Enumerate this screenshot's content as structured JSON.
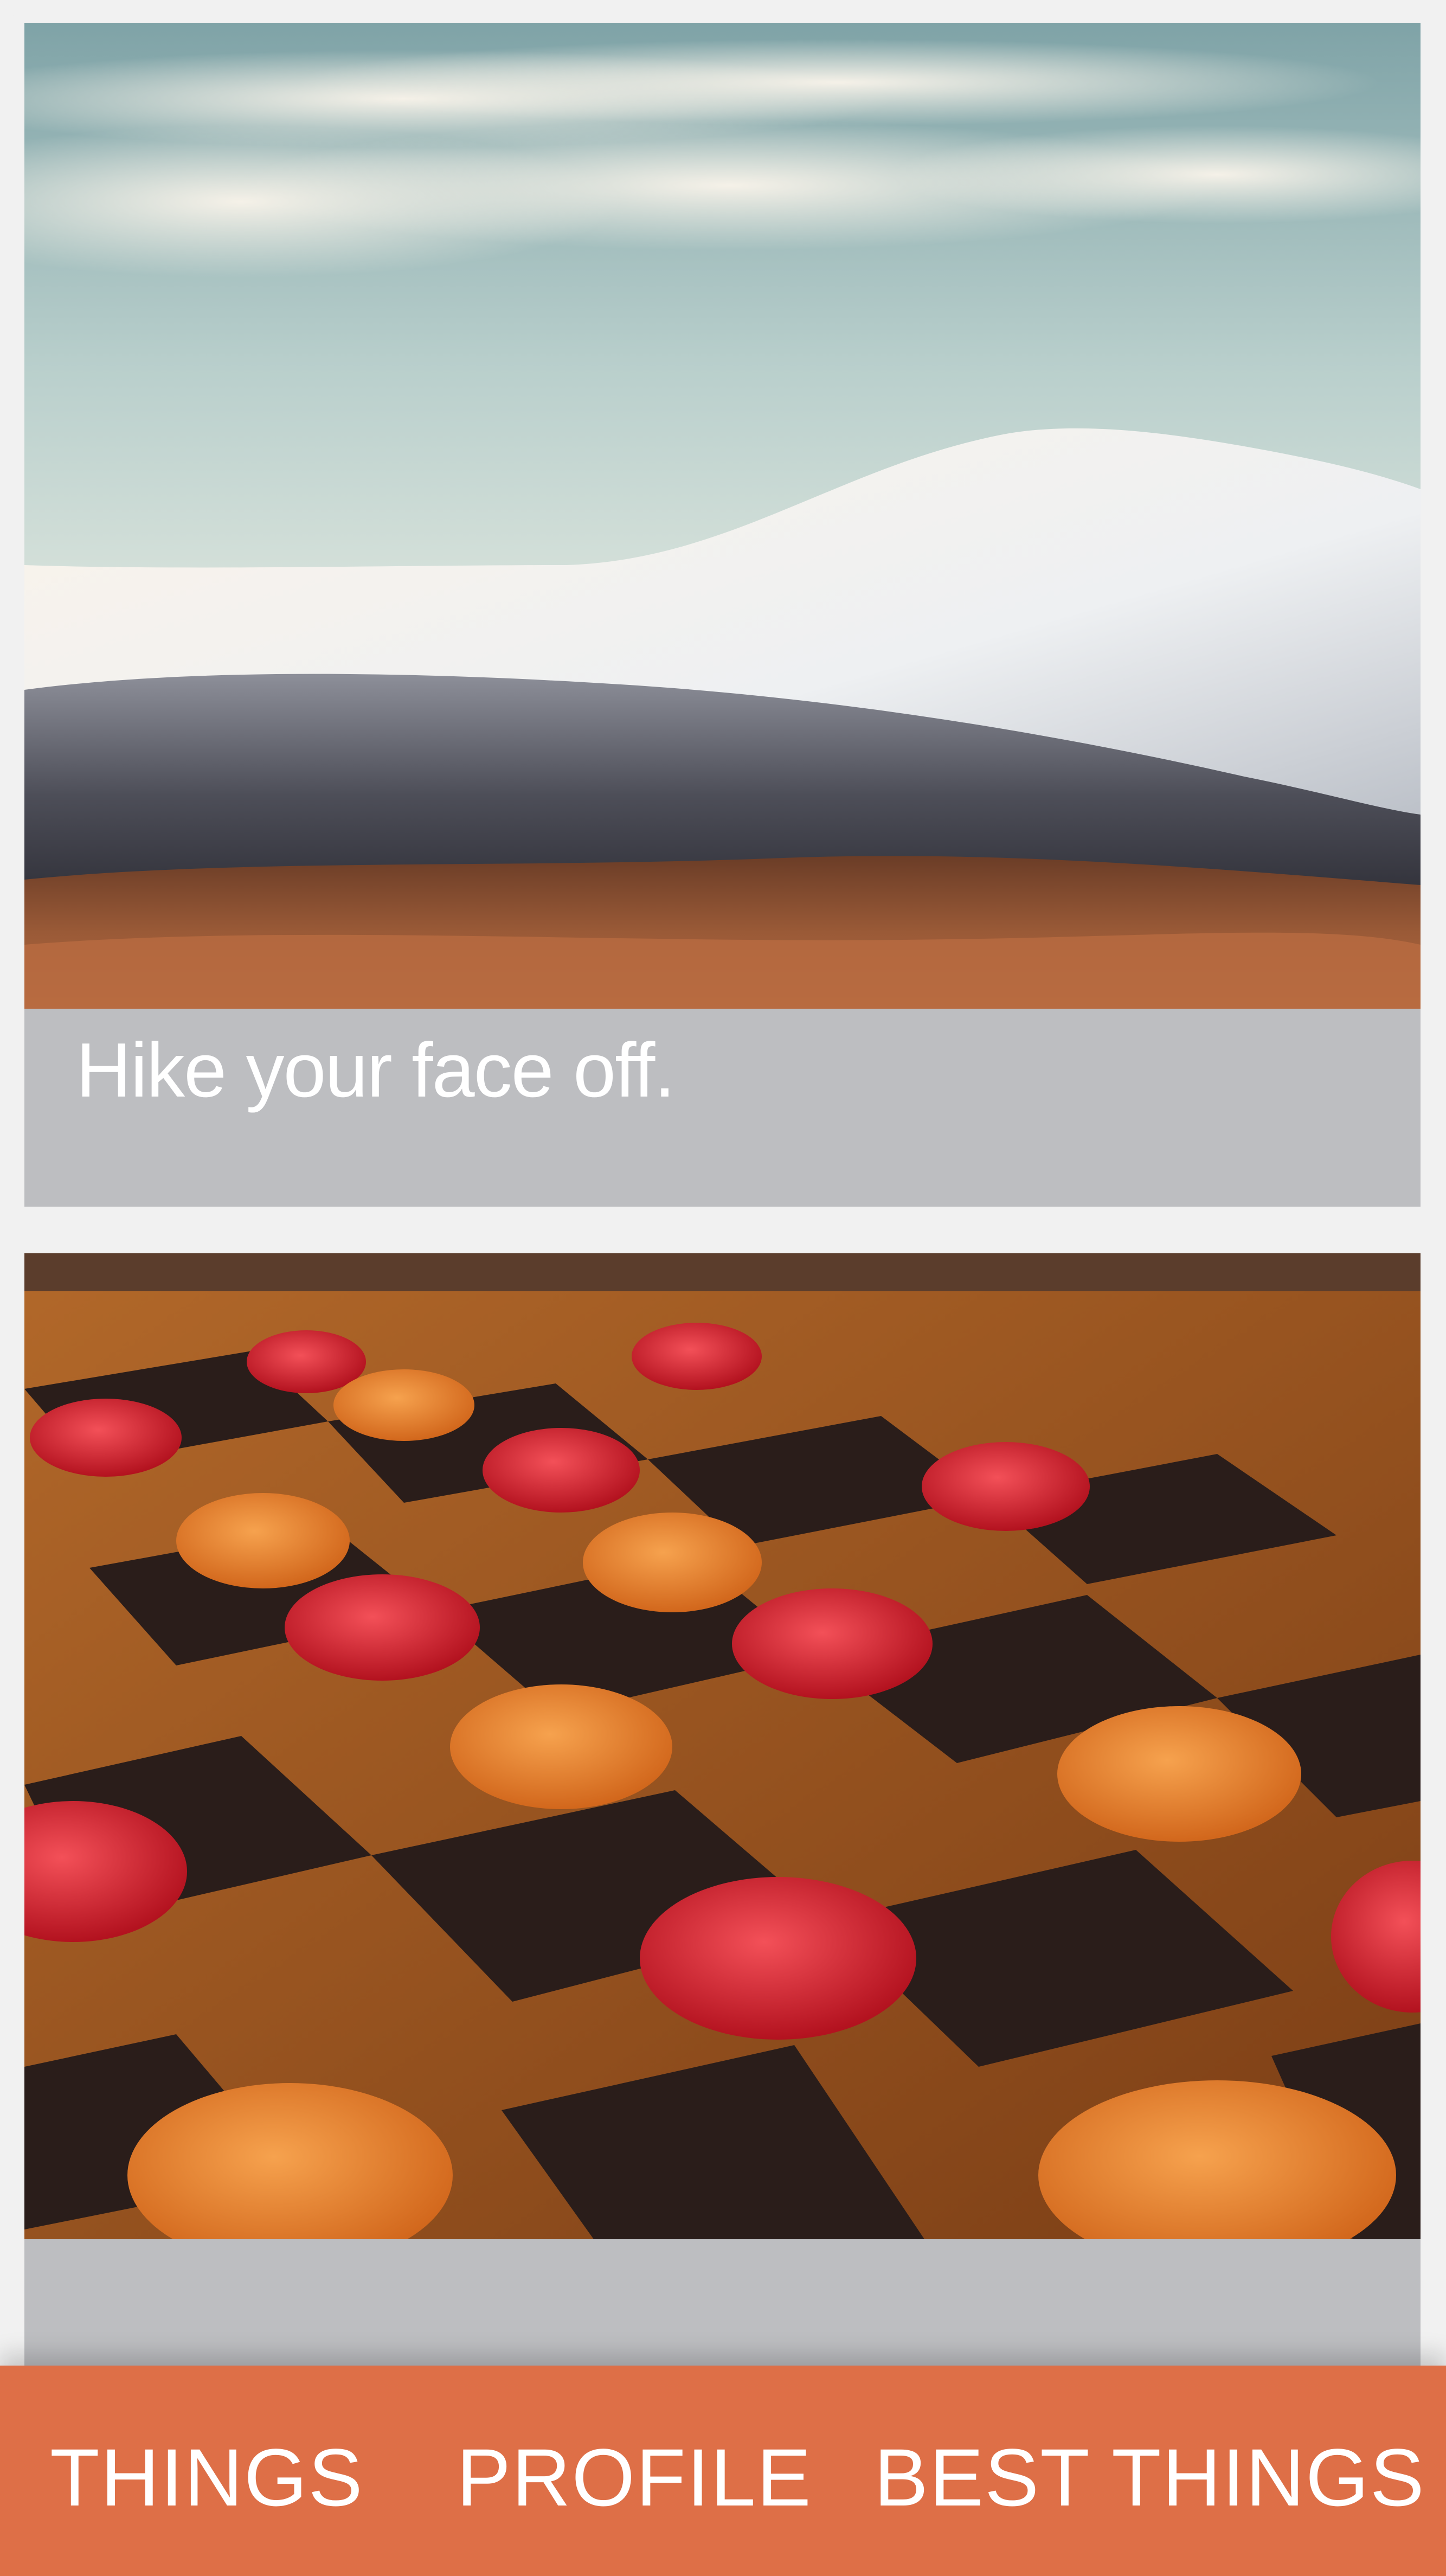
{
  "cards": [
    {
      "image": "snowy-mountain-landscape-photo",
      "caption": "Hike your face off."
    },
    {
      "image": "checkers-board-photo",
      "caption": ""
    }
  ],
  "nav": {
    "things": "THINGS",
    "profile": "PROFILE",
    "best_things": "BEST THINGS"
  },
  "colors": {
    "background": "#f1f1f1",
    "card_caption_bg": "#bdbec1",
    "nav_bar": "#de6f47",
    "nav_text": "#ffffff"
  }
}
